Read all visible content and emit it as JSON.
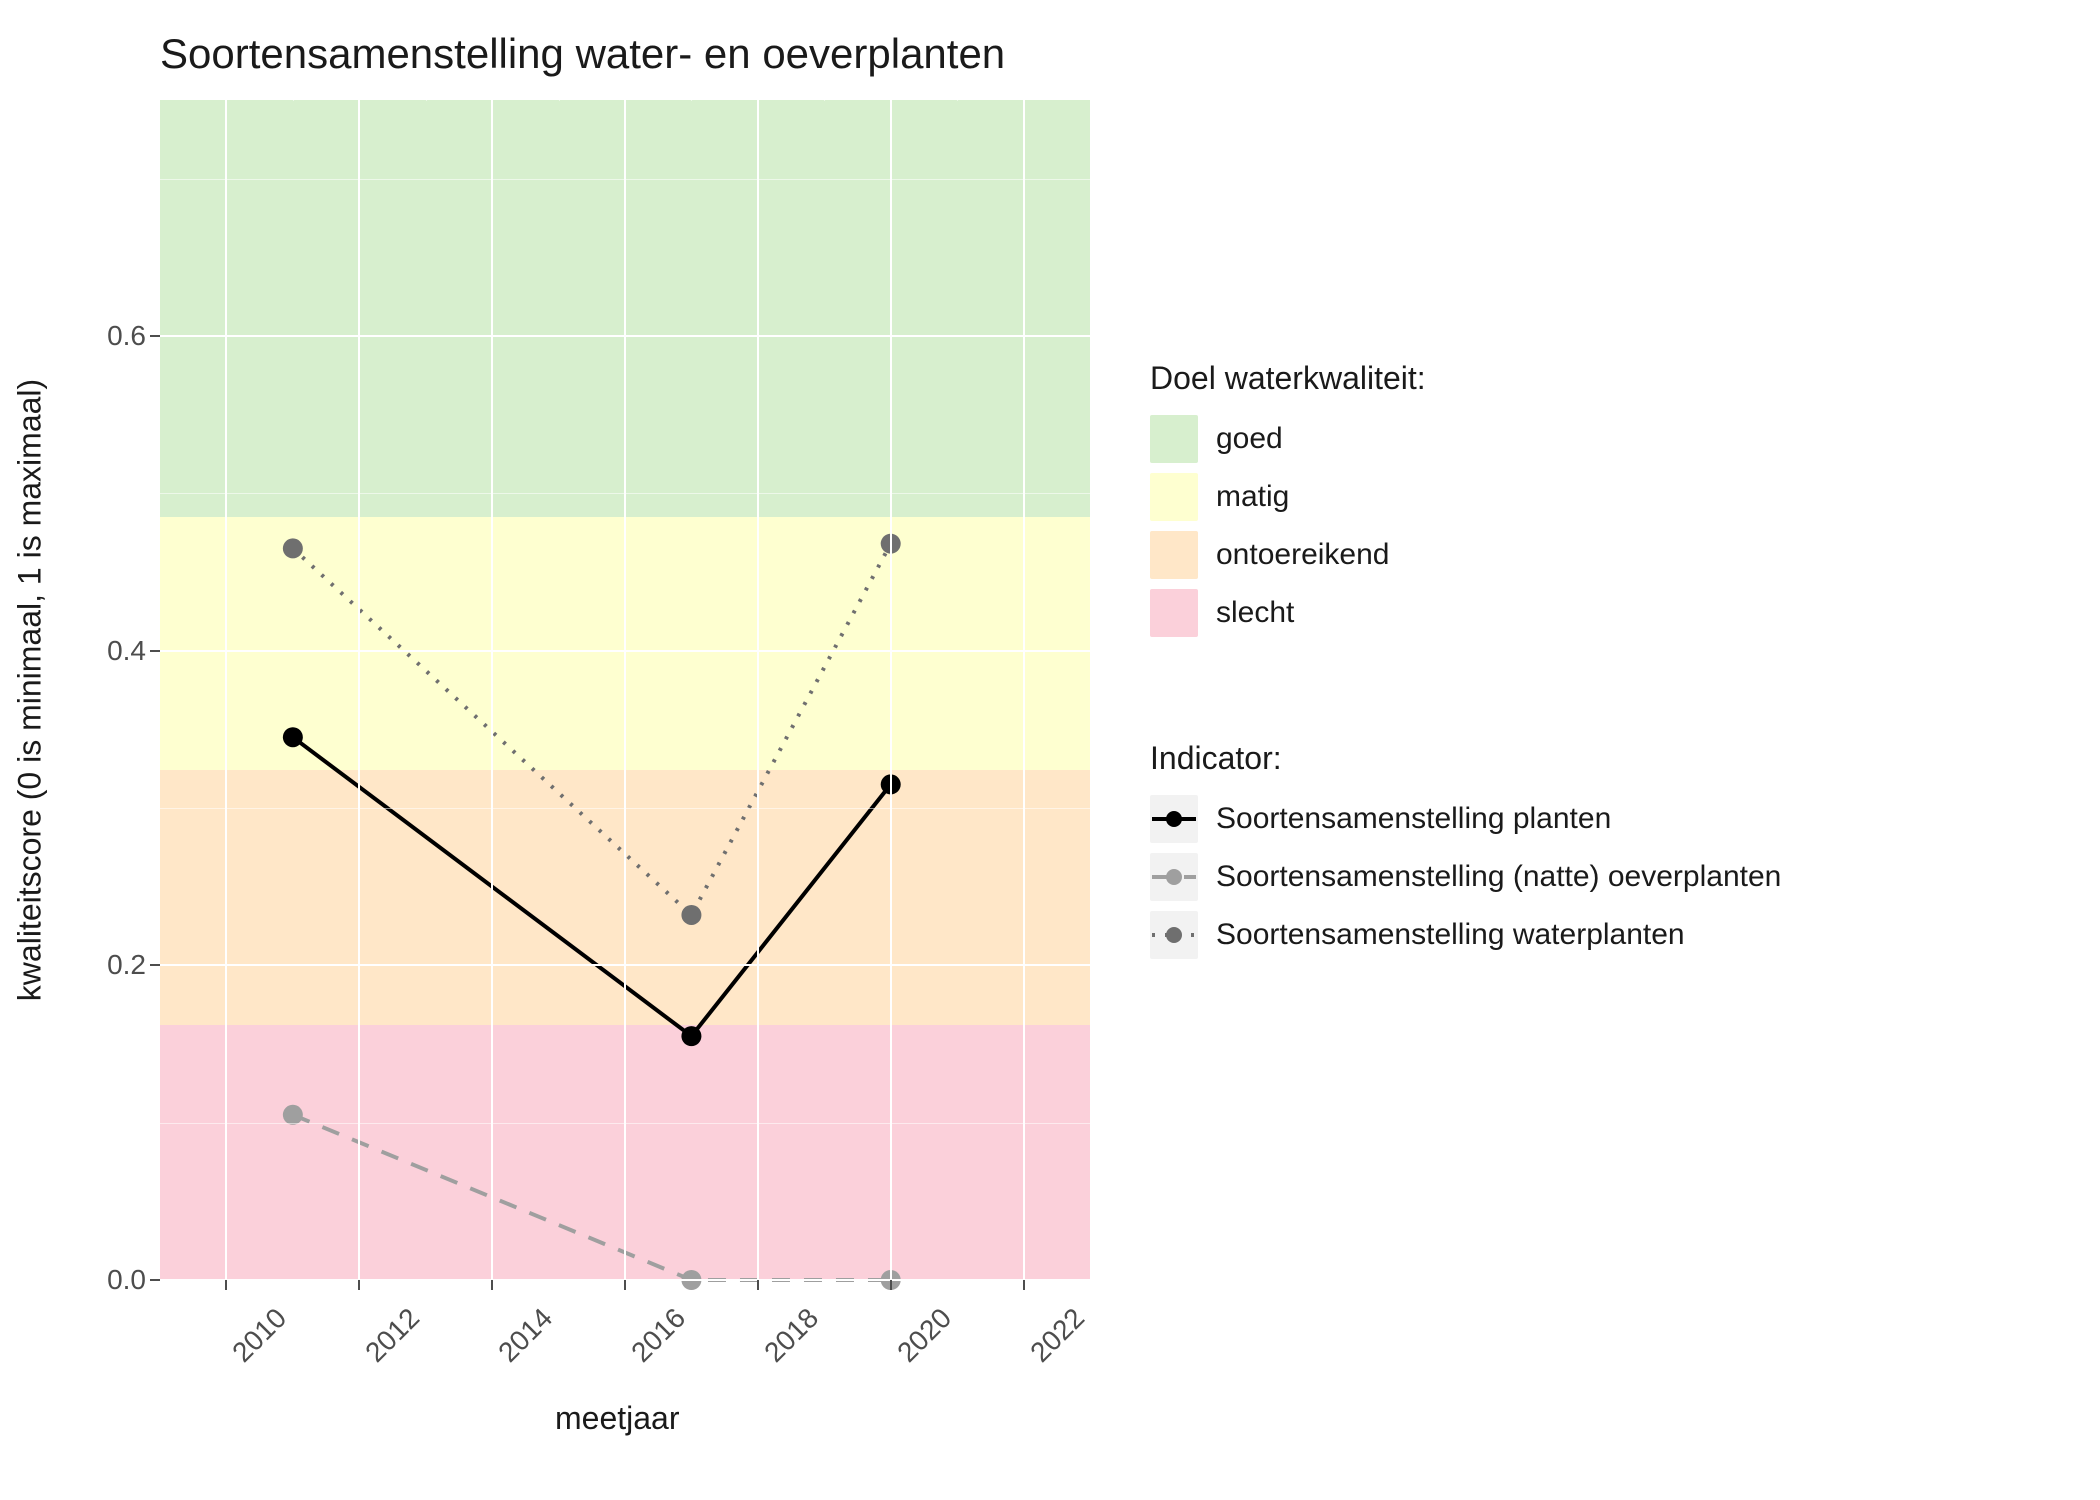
{
  "chart_data": {
    "type": "line",
    "title": "Soortensamenstelling water- en oeverplanten",
    "xlabel": "meetjaar",
    "ylabel": "kwaliteitscore (0 is minimaal, 1 is maximaal)",
    "xlim": [
      2009,
      2023
    ],
    "ylim": [
      0.0,
      0.75
    ],
    "xticks": [
      2010,
      2012,
      2014,
      2016,
      2018,
      2020,
      2022
    ],
    "yticks": [
      0.0,
      0.2,
      0.4,
      0.6
    ],
    "bands": {
      "title": "Doel waterkwaliteit:",
      "items": [
        {
          "label": "goed",
          "color": "#d7efce",
          "from": 0.485,
          "to": 0.75
        },
        {
          "label": "matig",
          "color": "#feffd0",
          "from": 0.324,
          "to": 0.485
        },
        {
          "label": "ontoereikend",
          "color": "#ffe7c8",
          "from": 0.162,
          "to": 0.324
        },
        {
          "label": "slecht",
          "color": "#fbd0da",
          "from": 0.0,
          "to": 0.162
        }
      ]
    },
    "series_title": "Indicator:",
    "x": [
      2011,
      2017,
      2020
    ],
    "series": [
      {
        "name": "Soortensamenstelling planten",
        "color": "#000000",
        "dash": "solid",
        "values": [
          0.345,
          0.155,
          0.315
        ]
      },
      {
        "name": "Soortensamenstelling (natte) oeverplanten",
        "color": "#9f9f9f",
        "dash": "dashed",
        "values": [
          0.105,
          0.0,
          0.0
        ]
      },
      {
        "name": "Soortensamenstelling waterplanten",
        "color": "#6f6f6f",
        "dash": "dotted",
        "values": [
          0.465,
          0.232,
          0.468
        ]
      }
    ]
  }
}
